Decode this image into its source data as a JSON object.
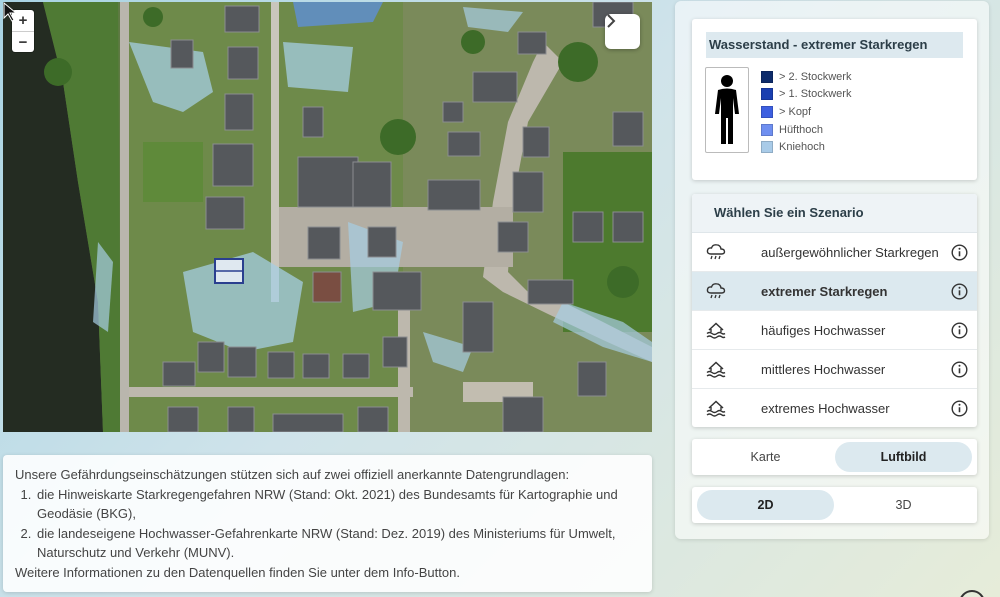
{
  "map": {
    "zoom_in": "+",
    "zoom_out": "−",
    "collapse_symbol": "›"
  },
  "legend": {
    "title": "Wasserstand - extremer Starkregen",
    "items": [
      {
        "label": "> 2. Stockwerk",
        "color": "#0d2b6b"
      },
      {
        "label": "> 1. Stockwerk",
        "color": "#1a3fb0"
      },
      {
        "label": "> Kopf",
        "color": "#3d5fe0"
      },
      {
        "label": "Hüfthoch",
        "color": "#6f8ff0"
      },
      {
        "label": "Kniehoch",
        "color": "#a9cbe8"
      }
    ]
  },
  "scenario": {
    "heading": "Wählen Sie ein Szenario",
    "options": [
      {
        "label": "außergewöhnlicher Starkregen",
        "icon": "rain-cloud-icon",
        "selected": false
      },
      {
        "label": "extremer Starkregen",
        "icon": "rain-cloud-icon",
        "selected": true
      },
      {
        "label": "häufiges Hochwasser",
        "icon": "flood-house-icon",
        "selected": false
      },
      {
        "label": "mittleres Hochwasser",
        "icon": "flood-house-icon",
        "selected": false
      },
      {
        "label": "extremes Hochwasser",
        "icon": "flood-house-icon",
        "selected": false
      }
    ]
  },
  "view_toggle": {
    "left": "Karte",
    "right": "Luftbild",
    "active": "Luftbild"
  },
  "dim_toggle": {
    "left": "2D",
    "right": "3D",
    "active": "2D"
  },
  "info": {
    "intro": "Unsere Gefährdungseinschätzungen stützen sich auf zwei offiziell anerkannte Datengrundlagen:",
    "sources": [
      "die Hinweiskarte Starkregengefahren NRW (Stand: Okt. 2021) des Bundesamts für Kartographie und Geodäsie (BKG),",
      "die landeseigene Hochwasser-Gefahrenkarte NRW (Stand: Dez. 2019) des Ministeriums für Umwelt, Naturschutz und Verkehr (MUNV)."
    ],
    "footer": "Weitere Informationen zu den Datenquellen finden Sie unter dem Info-Button."
  },
  "colors": {
    "accent": "#dce9ef",
    "text": "#2c3e48"
  }
}
